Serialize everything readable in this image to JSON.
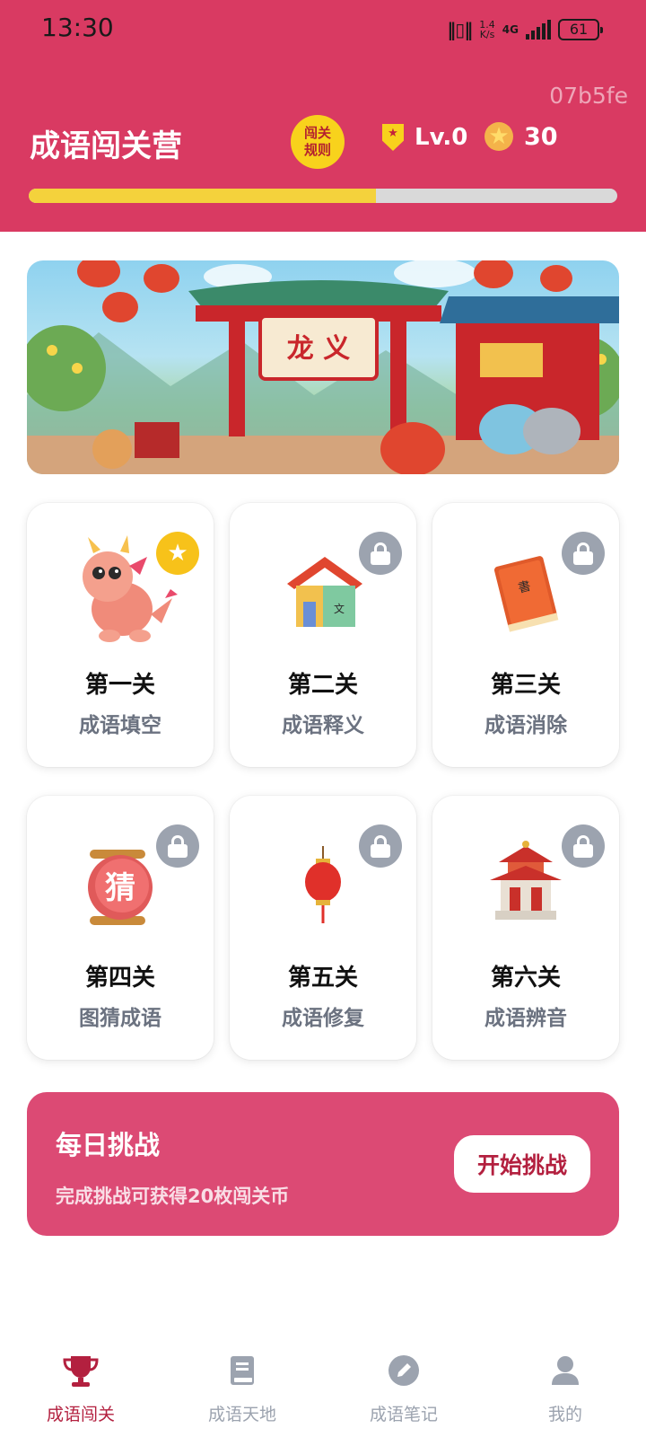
{
  "status_bar": {
    "time": "13:30",
    "net_speed_value": "1.4",
    "net_speed_unit": "K/s",
    "network": "4G",
    "battery": "61"
  },
  "watermark": "07b5fe",
  "header": {
    "title": "成语闯关营",
    "rules_badge_line1": "闯关",
    "rules_badge_line2": "规则",
    "level": "Lv.0",
    "coins": "30",
    "progress_fraction": 0.59,
    "colors": {
      "background": "#d93a62",
      "accent": "#f8d21c"
    }
  },
  "banner": {
    "sign_text": "龙 义",
    "icon": "chinese-temple-banner-illustration"
  },
  "levels": [
    {
      "title": "第一关",
      "subtitle": "成语填空",
      "status": "unlocked",
      "badge_icon": "star-icon",
      "art_icon": "dragon-icon"
    },
    {
      "title": "第二关",
      "subtitle": "成语释义",
      "status": "locked",
      "badge_icon": "lock-icon",
      "art_icon": "house-icon"
    },
    {
      "title": "第三关",
      "subtitle": "成语消除",
      "status": "locked",
      "badge_icon": "lock-icon",
      "art_icon": "book-icon"
    },
    {
      "title": "第四关",
      "subtitle": "图猜成语",
      "status": "locked",
      "badge_icon": "lock-icon",
      "art_icon": "scroll-icon",
      "art_text": "猜"
    },
    {
      "title": "第五关",
      "subtitle": "成语修复",
      "status": "locked",
      "badge_icon": "lock-icon",
      "art_icon": "lantern-icon"
    },
    {
      "title": "第六关",
      "subtitle": "成语辨音",
      "status": "locked",
      "badge_icon": "lock-icon",
      "art_icon": "pagoda-icon"
    }
  ],
  "daily_challenge": {
    "title": "每日挑战",
    "description": "完成挑战可获得20枚闯关币",
    "button_label": "开始挑战"
  },
  "bottom_nav": [
    {
      "label": "成语闯关",
      "icon": "trophy-icon",
      "active": true
    },
    {
      "label": "成语天地",
      "icon": "book-icon",
      "active": false
    },
    {
      "label": "成语笔记",
      "icon": "pencil-icon",
      "active": false
    },
    {
      "label": "我的",
      "icon": "user-icon",
      "active": false
    }
  ]
}
